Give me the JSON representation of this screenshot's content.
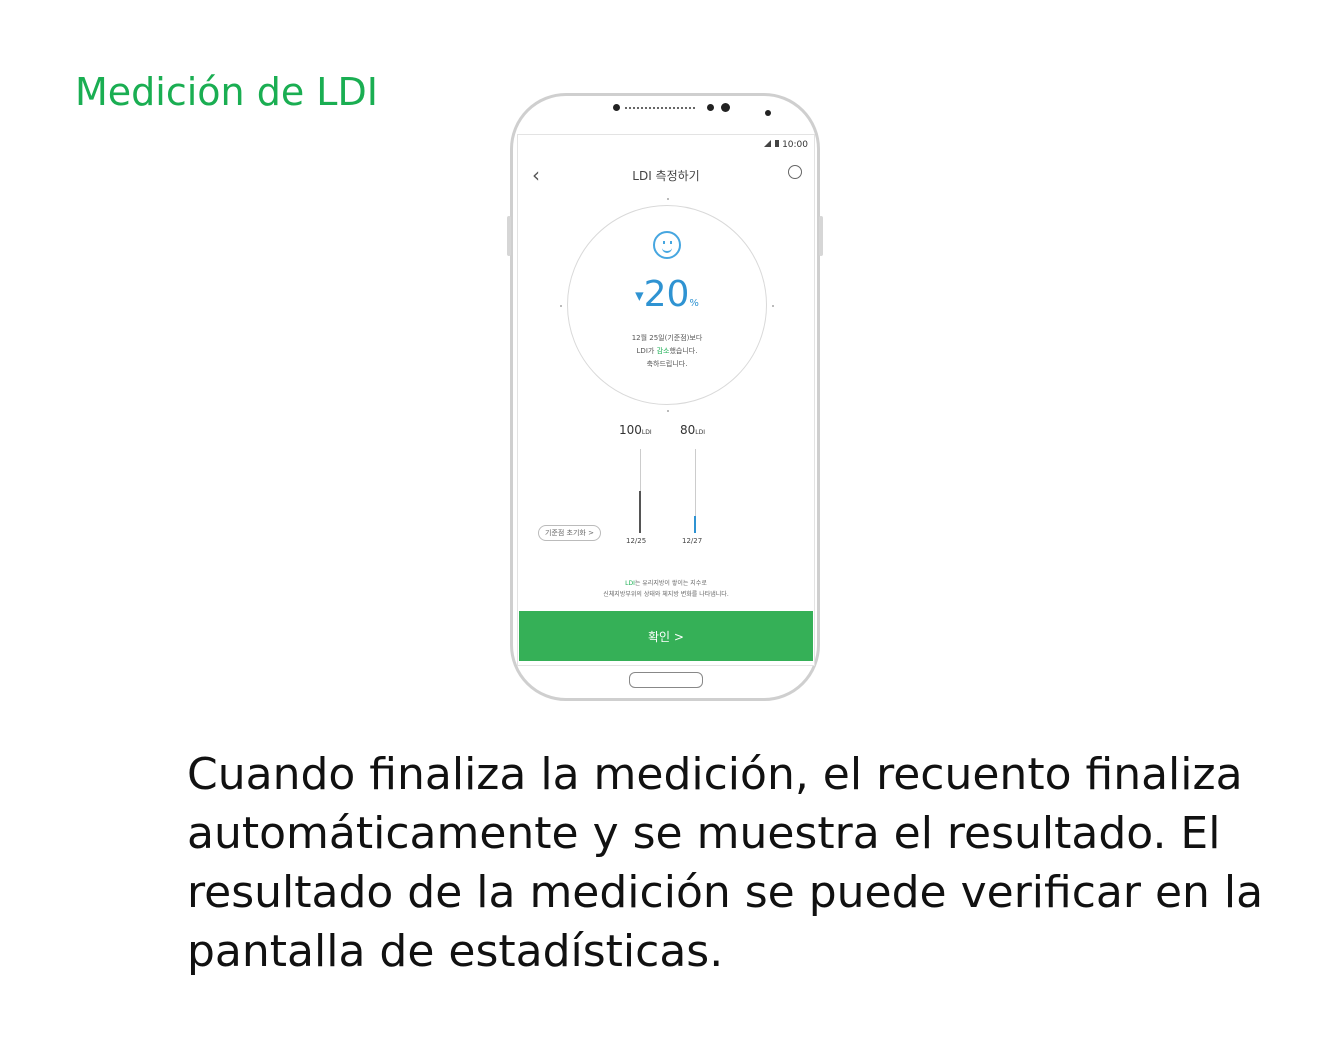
{
  "title": "Medición de LDI",
  "caption": "Cuando finaliza la medición, el recuento finaliza automáticamente y se muestra el resultado. El resultado de la medición se puede verificar en la pantalla de estadísticas.",
  "phone": {
    "status_time": "10:00",
    "app_title": "LDI 측정하기",
    "percent_value": "20",
    "percent_unit": "%",
    "message_line1": "12월 25일(기준점)보다",
    "message_line2_a": "LDI가 ",
    "message_line2_green": "감소",
    "message_line2_b": "했습니다.",
    "message_line3": "축하드립니다.",
    "bar1_value": "100",
    "bar1_unit": "LDI",
    "bar1_date": "12/25",
    "bar2_value": "80",
    "bar2_unit": "LDI",
    "bar2_date": "12/27",
    "baseline_button": "기준점 초기화 >",
    "note_line1_green": "LDI",
    "note_line1": "는 유리지방이 쌓이는 지수로",
    "note_line2": "신체지방부위의 상태와 체지방 변화를 나타냅니다.",
    "confirm_button": "확인 >",
    "bars": [
      {
        "date": "12/25",
        "value": 100,
        "color": "#555555"
      },
      {
        "date": "12/27",
        "value": 80,
        "color": "#2f93d2"
      }
    ]
  }
}
